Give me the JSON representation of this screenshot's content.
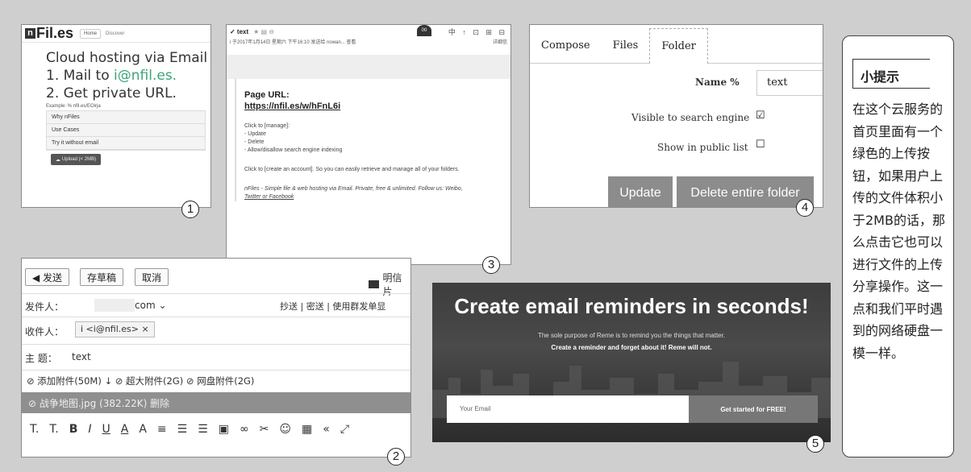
{
  "panel1": {
    "logo": "Fil.es",
    "logo_mark": "n",
    "tabs": [
      "Home",
      "Discover"
    ],
    "heading": "Cloud hosting via Email",
    "step1_prefix": "1. Mail to ",
    "step1_email": "i@nfil.es.",
    "step2": "2. Get private URL.",
    "example": "Example: % nfil.es/EOirja",
    "list": [
      "Why nFiles",
      "Use Cases",
      "Try it without email"
    ],
    "upload_label": "Upload (< 2MB)",
    "badge": "1"
  },
  "panel3": {
    "subject": "✓ text",
    "subject_icons": "★ ▤ ⊖",
    "meta": "i 于2017年1月14日 星期六 下午16:10 发送给 nowan...   查看",
    "meta_right": "详细信",
    "avatar": "00",
    "top_icons": "中 ↑ ⊡ ⊞ ⊟",
    "page_url_label": "Page URL:",
    "page_url": "https://nfil.es/w/hFnL6i",
    "click_manage": "Click to [manage]:",
    "actions": [
      "- Update",
      "- Delete",
      "- Allow/disallow search engine indexing"
    ],
    "click_account": "Click to [create an account]. So you can easily retrieve and manage all of your folders.",
    "footer1": "nFiles - Simple file & web hosting via Email. Private, free & unlimited. Follow us: Weibo,",
    "footer2": "Twitter or Facebook",
    "badge": "3"
  },
  "panel4": {
    "tabs": [
      "Compose",
      "Files",
      "Folder"
    ],
    "name_label": "Name %",
    "name_value": "text",
    "visible_label": "Visible to search engine",
    "visible_checked": "☑",
    "public_label": "Show in public list",
    "public_checked": "☐",
    "update_label": "Update",
    "delete_label": "Delete entire folder",
    "badge": "4"
  },
  "tip": {
    "title": "小提示",
    "body": "在这个云服务的首页里面有一个绿色的上传按钮，如果用户上传的文件体积小于2MB的话，那么点击它也可以进行文件的上传分享操作。这一点和我们平时遇到的网络硬盘一模一样。"
  },
  "panel2": {
    "send_label": "◀ 发送",
    "draft_label": "存草稿",
    "cancel_label": "取消",
    "postcard_label": "明信片",
    "from_label": "发件人：",
    "from_value": "com ⌄",
    "cc_links": "抄送 | 密送 | 使用群发单显",
    "to_label": "收件人：",
    "to_value": "i <i@nfil.es> ×",
    "subject_label": "主  题：",
    "subject_value": "text",
    "attach_links": "⊘ 添加附件(50M) ↓ ⊘ 超大附件(2G) ⊘ 网盘附件(2G)",
    "attachment": "⊘ 战争地图.jpg (382.22K) 删除",
    "toolbar": [
      "T.",
      "T.",
      "B",
      "I",
      "U",
      "A",
      "A",
      "≡",
      "☰",
      "☰",
      "▣",
      "∞",
      "✂",
      "☺",
      "▦",
      "«",
      "⤢"
    ],
    "badge": "2"
  },
  "panel5": {
    "title": "Create email reminders in seconds!",
    "sub1": "The sole purpose of Reme is to remind you the things that matter.",
    "sub2": "Create a reminder and forget about it! Reme will not.",
    "email_placeholder": "Your Email",
    "cta": "Get started for FREE!",
    "badge": "5"
  }
}
